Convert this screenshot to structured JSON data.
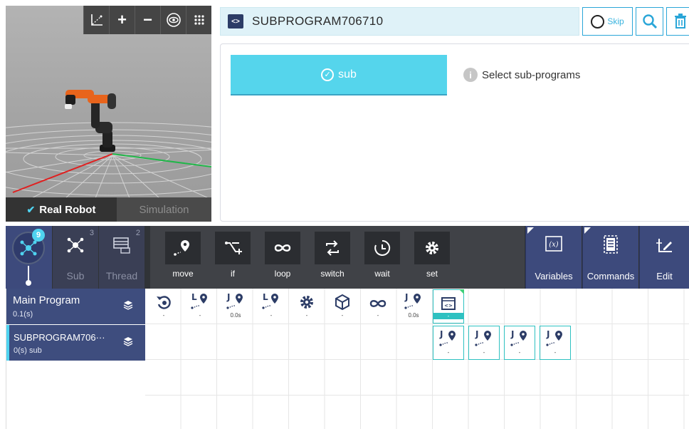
{
  "viewport": {
    "toolbar": [
      "axes-icon",
      "zoom-in-icon",
      "zoom-out-icon",
      "eye-icon",
      "grid-icon"
    ],
    "tabs": {
      "real": "Real Robot",
      "simulation": "Simulation"
    }
  },
  "program": {
    "title": "SUBPROGRAM706710",
    "skip_label": "Skip"
  },
  "editor": {
    "sub_button": "sub",
    "hint": "Select sub-programs"
  },
  "program_tabs": {
    "main_badge": "9",
    "sub": {
      "label": "Sub",
      "badge": "3"
    },
    "thread": {
      "label": "Thread",
      "badge": "2"
    }
  },
  "commands": [
    "move",
    "if",
    "loop",
    "switch",
    "wait",
    "set"
  ],
  "side_buttons": [
    "Variables",
    "Commands",
    "Edit"
  ],
  "lanes": {
    "main": {
      "name": "Main Program",
      "time": "0.1(s)"
    },
    "sub": {
      "name": "SUBPROGRAM706···",
      "time": "0(s) sub"
    }
  },
  "timeline_main": [
    {
      "icon": "rotate-icon",
      "val": "-"
    },
    {
      "icon": "move-l-icon",
      "letter": "L",
      "val": "-"
    },
    {
      "icon": "move-j-icon",
      "letter": "J",
      "val": "0.0s"
    },
    {
      "icon": "move-l-icon",
      "letter": "L",
      "val": "-"
    },
    {
      "icon": "gear-icon",
      "val": "-"
    },
    {
      "icon": "cube-icon",
      "val": "-"
    },
    {
      "icon": "loop-icon",
      "val": "-"
    },
    {
      "icon": "move-j-icon",
      "letter": "J",
      "val": "0.0s"
    },
    {
      "icon": "code-icon",
      "val": "-"
    }
  ],
  "timeline_sub": [
    {
      "icon": "move-j-icon",
      "letter": "J",
      "val": "-"
    },
    {
      "icon": "move-j-icon",
      "letter": "J",
      "val": "-"
    },
    {
      "icon": "move-j-icon",
      "letter": "J",
      "val": "-"
    },
    {
      "icon": "move-j-icon",
      "letter": "J",
      "val": "-"
    }
  ],
  "colors": {
    "accent": "#55d5ec",
    "navy": "#3e4d7e",
    "teal": "#2ec1c1"
  }
}
